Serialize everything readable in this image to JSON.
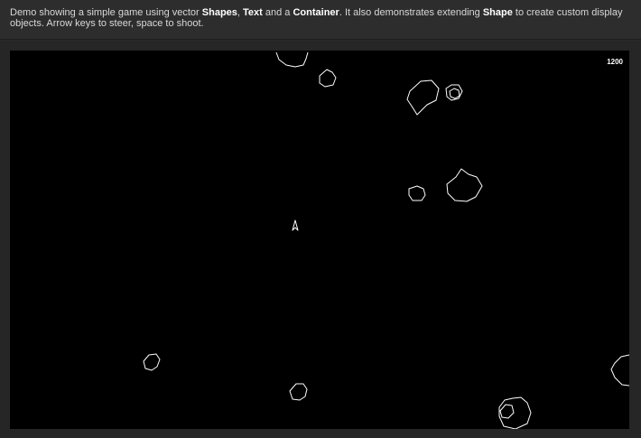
{
  "description": {
    "p1": "Demo showing a simple game using vector ",
    "b1": "Shapes",
    "p2": ", ",
    "b2": "Text",
    "p3": " and a ",
    "b3": "Container",
    "p4": ". It also demonstrates extending ",
    "b4": "Shape",
    "p5": " to create custom display objects. Arrow keys to steer, space to shoot."
  },
  "game": {
    "score": "1200",
    "background_color": "#000000",
    "stroke_color": "#ffffff",
    "ship_heading": "up"
  }
}
